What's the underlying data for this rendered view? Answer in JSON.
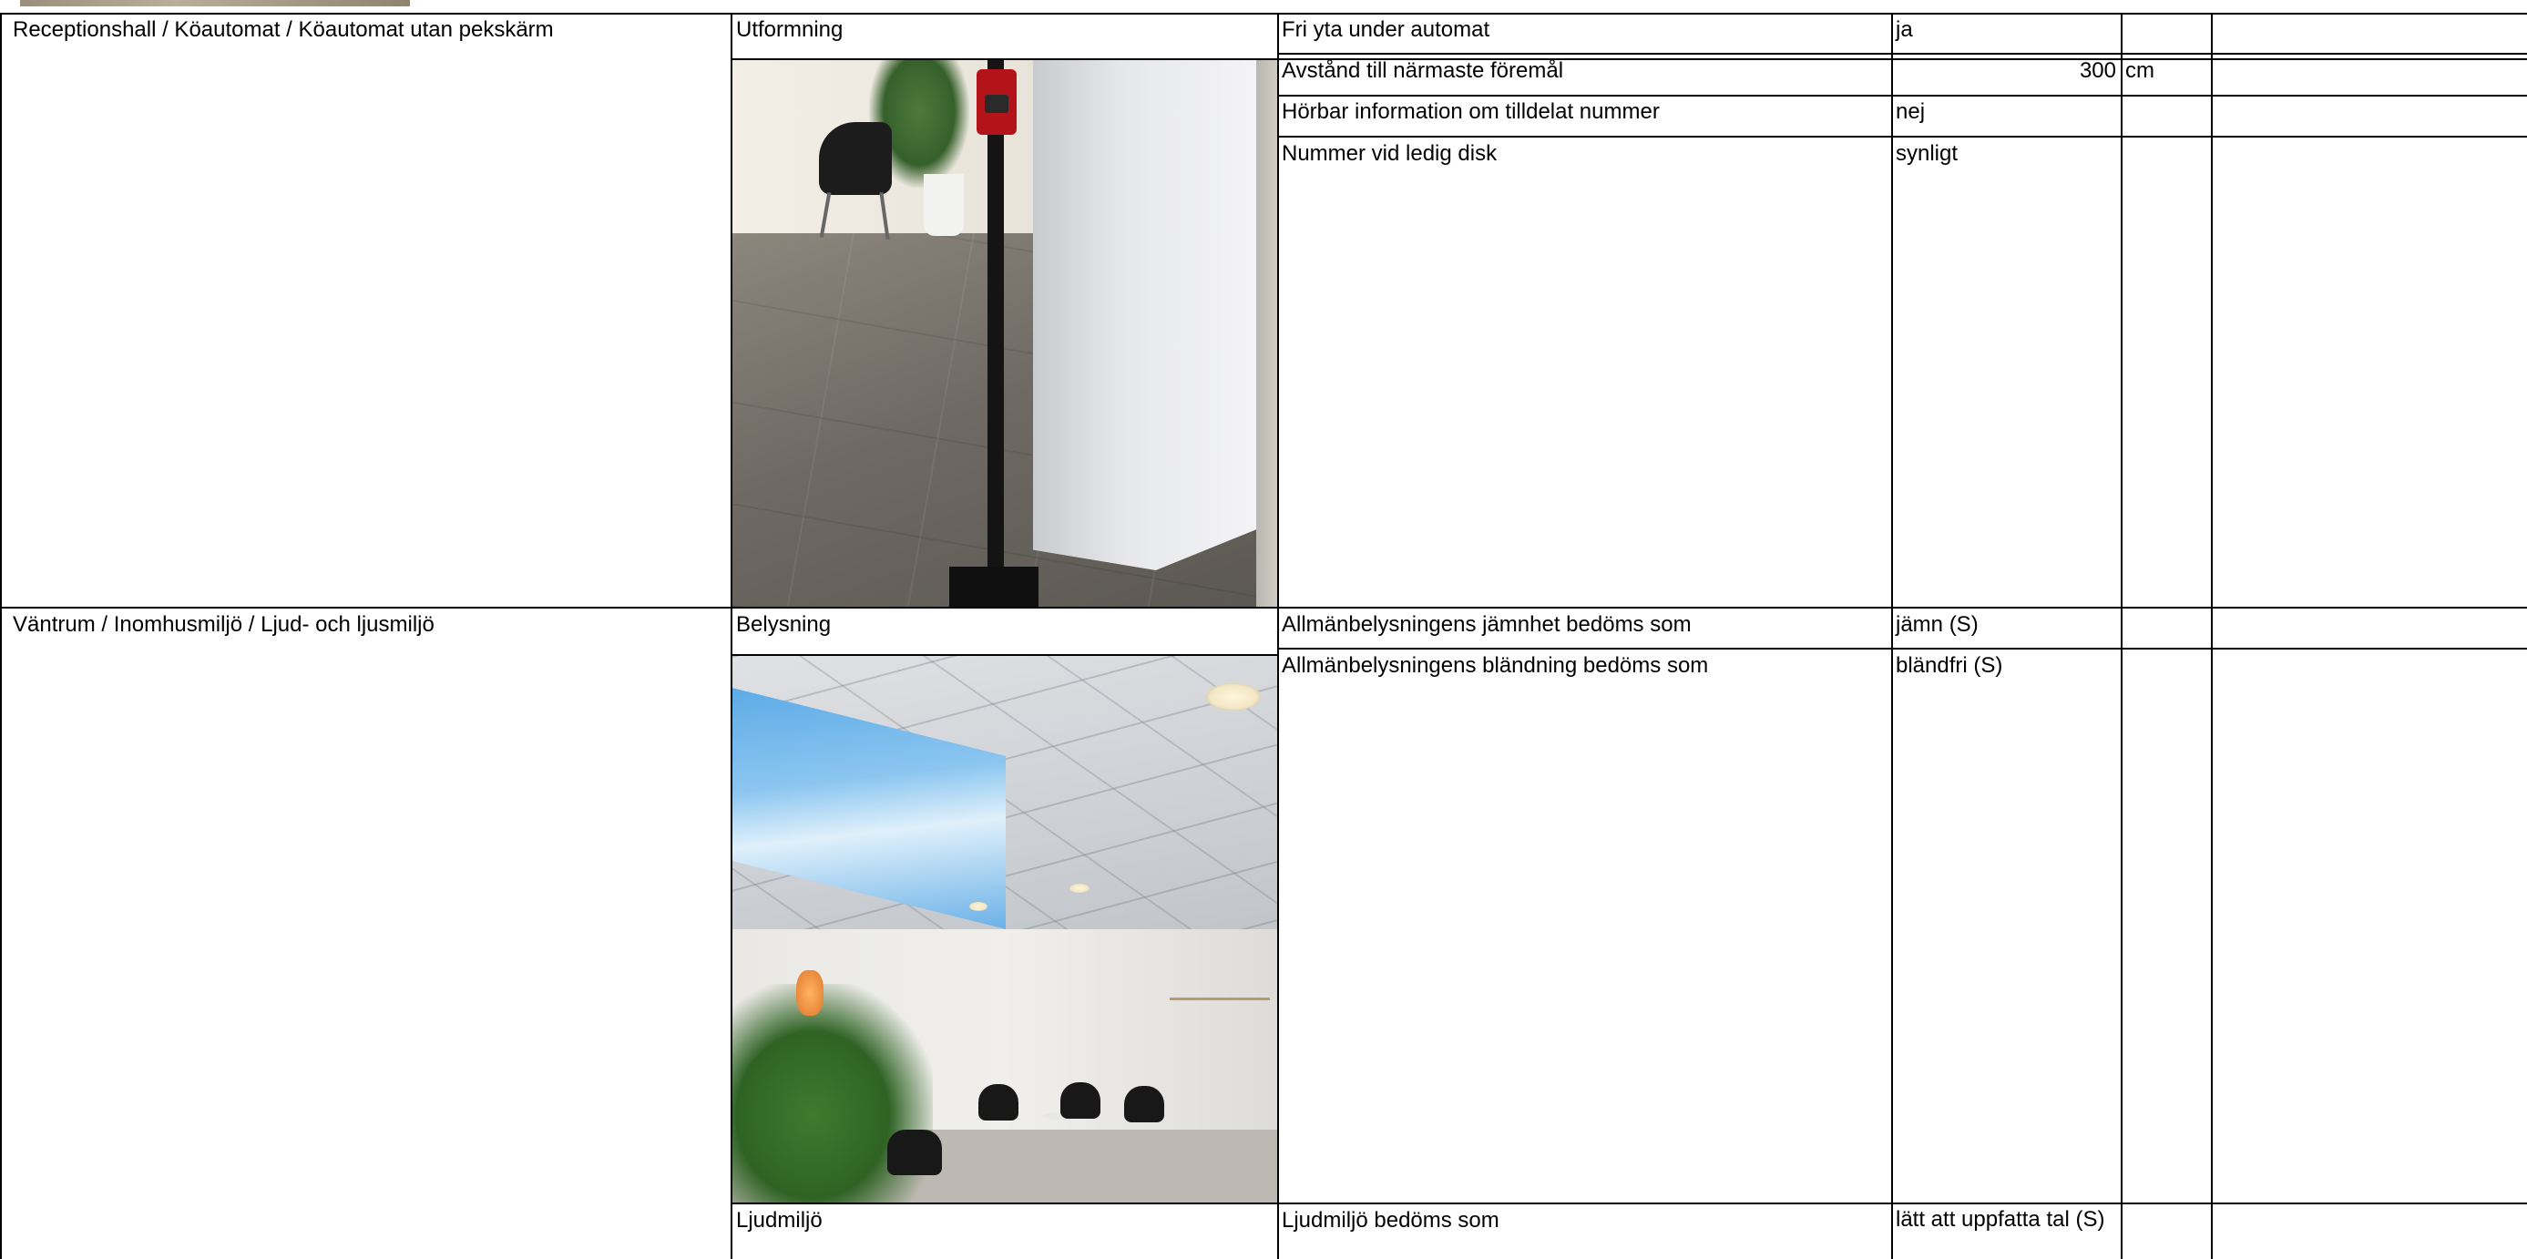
{
  "rows": [
    {
      "path": "Receptionshall / Köautomat / Köautomat utan pekskärm",
      "section": "Utformning",
      "photo": "queue-machine-photo",
      "items": [
        {
          "label": "Fri yta under automat",
          "value": "ja",
          "unit": ""
        },
        {
          "label": "Avstånd till närmaste föremål",
          "value": "300",
          "unit": "cm"
        },
        {
          "label": "Hörbar information om tilldelat nummer",
          "value": "nej",
          "unit": ""
        },
        {
          "label": "Nummer vid ledig disk",
          "value": "synligt",
          "unit": ""
        }
      ]
    },
    {
      "path": "Väntrum / Inomhusmiljö / Ljud- och ljusmiljö",
      "section": "Belysning",
      "photo": "waiting-room-photo",
      "items": [
        {
          "label": "Allmänbelysningens jämnhet bedöms som",
          "value": "jämn (S)",
          "unit": ""
        },
        {
          "label": "Allmänbelysningens bländning bedöms som",
          "value": "bländfri (S)",
          "unit": ""
        }
      ],
      "section2": "Ljudmiljö",
      "items2": [
        {
          "label": "Ljudmiljö bedöms som",
          "value": "lätt att uppfatta tal (S)",
          "unit": ""
        }
      ]
    }
  ]
}
